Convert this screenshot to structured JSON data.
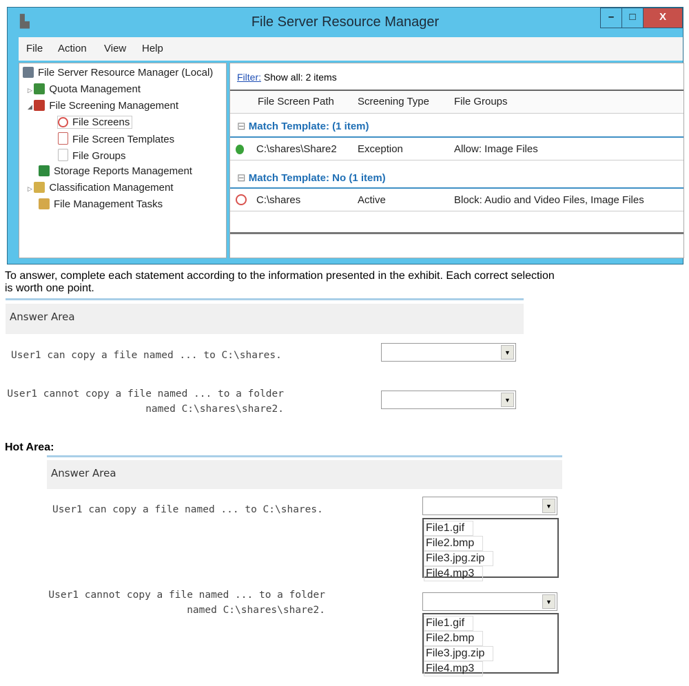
{
  "window": {
    "title": "File Server Resource Manager",
    "minimize": "–",
    "maximize": "□",
    "close": "X"
  },
  "menu": [
    "File",
    "Action",
    "View",
    "Help"
  ],
  "tree": [
    {
      "label": "File Server Resource Manager (Local)",
      "color": "#6b7b8c"
    },
    {
      "label": "Quota Management",
      "color": "#3c8f3c"
    },
    {
      "label": "File Screening Management",
      "color": "#c0392b"
    },
    {
      "label": "File Screens",
      "color": "#d9534f"
    },
    {
      "label": "File Screen Templates",
      "color": "#c9605a"
    },
    {
      "label": "File Groups",
      "color": "#dddddd"
    },
    {
      "label": "Storage Reports Management",
      "color": "#2e8b3e"
    },
    {
      "label": "Classification Management",
      "color": "#d4b04a"
    },
    {
      "label": "File Management Tasks",
      "color": "#d4a84a"
    }
  ],
  "filter": {
    "link": "Filter:",
    "text": "Show all: 2 items"
  },
  "columns": [
    "File Screen Path",
    "Screening Type",
    "File Groups"
  ],
  "groups": [
    {
      "title": "Match Template: (1 item)",
      "row": {
        "path": "C:\\shares\\Share2",
        "type": "Exception",
        "groups": "Allow: Image Files",
        "icon_color": "#3aa23a"
      }
    },
    {
      "title": "Match Template: No (1 item)",
      "row": {
        "path": "C:\\shares",
        "type": "Active",
        "groups": "Block: Audio and Video Files, Image Files",
        "icon_color": "#d9534f"
      }
    }
  ],
  "instructions": "To answer, complete each statement according to the information presented in the exhibit. Each correct selection is worth one point.",
  "answer_area": {
    "title": "Answer Area",
    "q1": "User1 can copy a file named ... to C:\\shares.",
    "q2a": "User1 cannot copy a file named ... to a folder",
    "q2b": "named C:\\shares\\share2."
  },
  "hot_area": {
    "label": "Hot Area:",
    "title": "Answer Area",
    "options": [
      "File1.gif",
      "File2.bmp",
      "File3.jpg.zip",
      "File4.mp3"
    ]
  }
}
